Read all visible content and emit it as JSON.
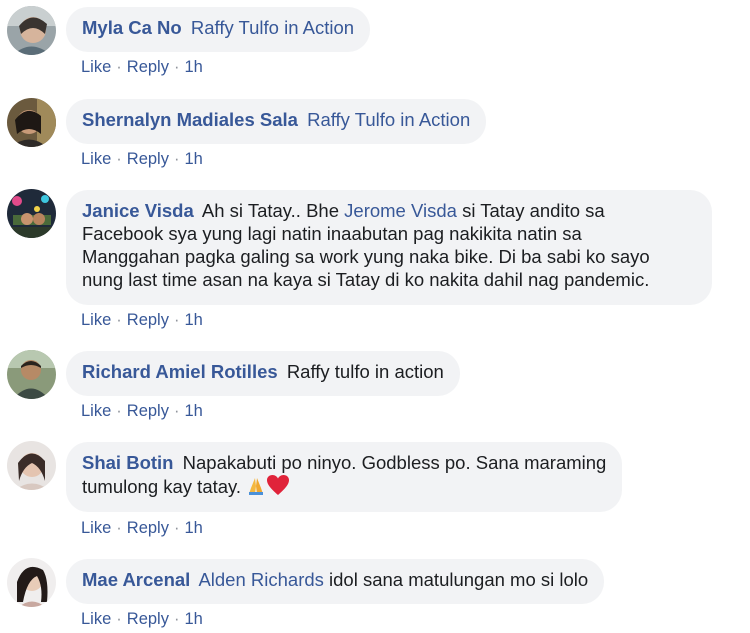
{
  "comments": [
    {
      "author": "Myla Ca No",
      "mention": "Raffy Tulfo in Action",
      "text": "",
      "like": "Like",
      "reply": "Reply",
      "time": "1h",
      "avatar_icon": "profile-photo"
    },
    {
      "author": "Shernalyn Madiales Sala",
      "mention": "Raffy Tulfo in Action",
      "text": "",
      "like": "Like",
      "reply": "Reply",
      "time": "1h",
      "avatar_icon": "profile-photo"
    },
    {
      "author": "Janice Visda",
      "text_before": "Ah si Tatay.. Bhe",
      "mention": "Jerome Visda",
      "line1_after": "si Tatay andito sa",
      "line2": "Facebook sya yung lagi natin inaabutan pag nakikita natin sa",
      "line3": "Manggahan pagka galing sa work yung naka bike. Di ba sabi ko sayo",
      "line4": "nung last time asan na kaya si Tatay di ko nakita dahil nag pandemic.",
      "like": "Like",
      "reply": "Reply",
      "time": "1h",
      "avatar_icon": "profile-photo"
    },
    {
      "author": "Richard Amiel Rotilles",
      "text": "Raffy tulfo in action",
      "like": "Like",
      "reply": "Reply",
      "time": "1h",
      "avatar_icon": "profile-photo"
    },
    {
      "author": "Shai Botin",
      "line1": "Napakabuti po ninyo. Godbless po. Sana maraming",
      "line2": "tumulong kay tatay.",
      "emojis": [
        "folded-hands-emoji",
        "red-heart-emoji"
      ],
      "like": "Like",
      "reply": "Reply",
      "time": "1h",
      "avatar_icon": "profile-photo"
    },
    {
      "author": "Mae Arcenal",
      "mention": "Alden Richards",
      "text": "idol sana matulungan mo si lolo",
      "like": "Like",
      "reply": "Reply",
      "time": "1h",
      "avatar_icon": "profile-photo"
    }
  ],
  "colors": {
    "link": "#385898",
    "bubble": "#f2f3f5",
    "text": "#1c1e21",
    "meta": "#90949c"
  }
}
